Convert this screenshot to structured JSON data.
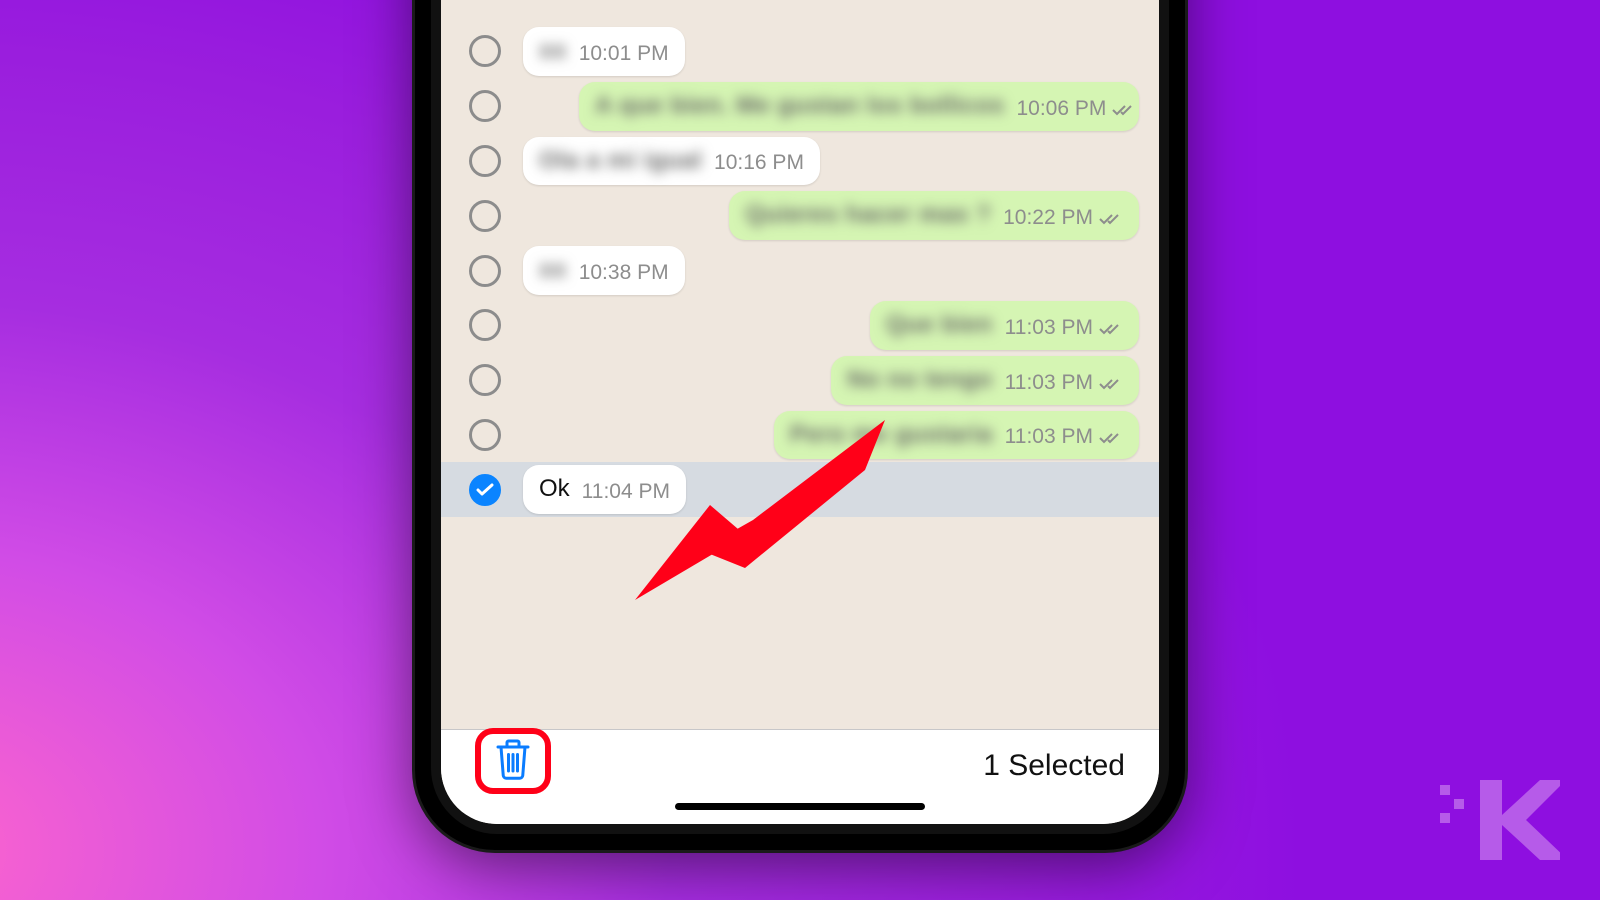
{
  "messages": [
    {
      "dir": "in",
      "blurred": true,
      "time": "10:01 PM"
    },
    {
      "dir": "out",
      "blurred": true,
      "time": "10:06 PM"
    },
    {
      "dir": "in",
      "blurred": true,
      "time": "10:16 PM"
    },
    {
      "dir": "out",
      "blurred": true,
      "time": "10:22 PM"
    },
    {
      "dir": "in",
      "blurred": true,
      "time": "10:38 PM"
    },
    {
      "dir": "out",
      "blurred": true,
      "time": "11:03 PM"
    },
    {
      "dir": "out",
      "blurred": true,
      "time": "11:03 PM"
    },
    {
      "dir": "out",
      "blurred": true,
      "time": "11:03 PM"
    },
    {
      "dir": "in",
      "text": "Ok",
      "time": "11:04 PM",
      "selected": true
    }
  ],
  "toolbar": {
    "selected_count": "1 Selected"
  },
  "arrow_target": "selected-message",
  "highlight_target": "delete-button"
}
